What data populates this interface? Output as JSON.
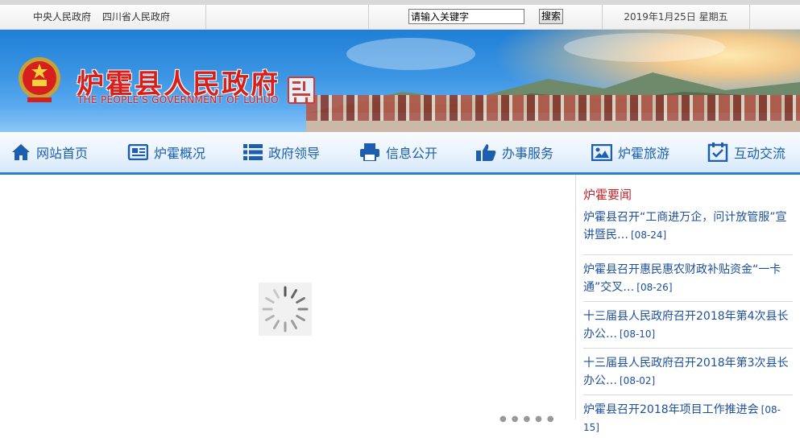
{
  "topbar": {
    "links": [
      "中央人民政府",
      "四川省人民政府"
    ],
    "search_placeholder": "请输入关键字",
    "search_button": "搜索",
    "date": "2019年1月25日  星期五"
  },
  "header": {
    "title": "炉霍县人民政府",
    "subtitle": "THE PEOPLE'S GOVERNMENT OF LUHUO"
  },
  "nav": [
    {
      "label": "网站首页",
      "icon": "home-icon"
    },
    {
      "label": "炉霍概况",
      "icon": "newspaper-icon"
    },
    {
      "label": "政府领导",
      "icon": "list-icon"
    },
    {
      "label": "信息公开",
      "icon": "printer-icon"
    },
    {
      "label": "办事服务",
      "icon": "thumbs-up-icon"
    },
    {
      "label": "炉霍旅游",
      "icon": "picture-icon"
    },
    {
      "label": "互动交流",
      "icon": "calendar-check-icon"
    }
  ],
  "news": {
    "title": "炉霍要闻",
    "items": [
      {
        "text": "炉霍县召开“工商进万企，问计放管服”宣讲暨民…",
        "date": "[08-24]"
      },
      {
        "text": "炉霍县召开惠民惠农财政补贴资金“一卡通”交叉…",
        "date": "[08-26]"
      },
      {
        "text": "十三届县人民政府召开2018年第4次县长办公…",
        "date": "[08-10]"
      },
      {
        "text": "十三届县人民政府召开2018年第3次县长办公…",
        "date": "[08-02]"
      },
      {
        "text": "炉霍县召开2018年项目工作推进会",
        "date": "[08-15]"
      }
    ]
  },
  "colors": {
    "accent": "#2f7fd0",
    "title_red": "#d7201b",
    "news_red": "#c1272d",
    "link_blue": "#1d4f9a"
  }
}
